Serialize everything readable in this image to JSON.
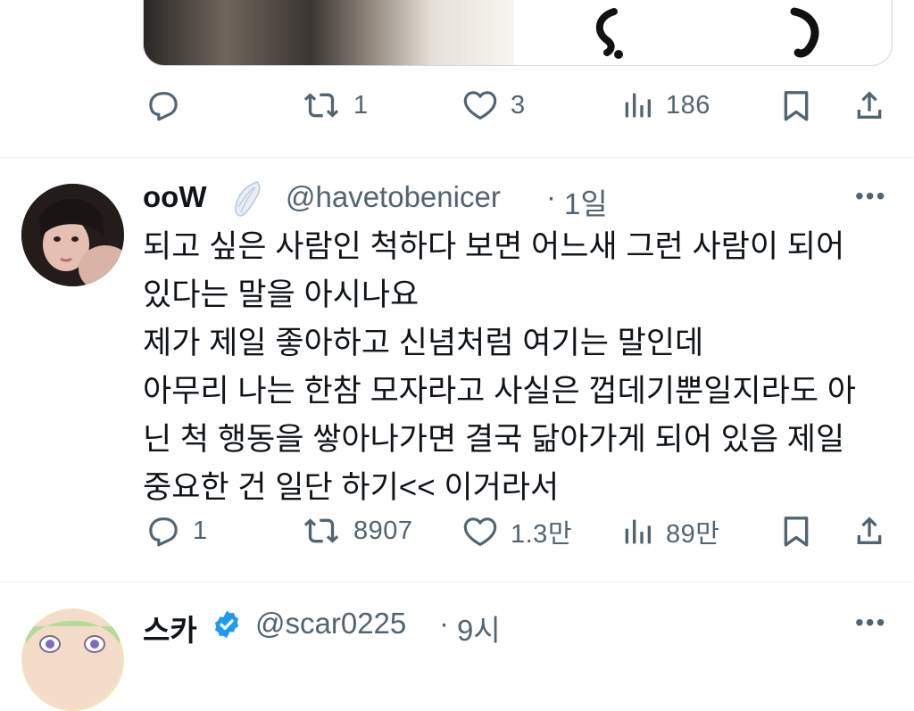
{
  "tweet1": {
    "stats": {
      "reply": "",
      "retweet": "1",
      "like": "3",
      "views": "186"
    }
  },
  "tweet2": {
    "name": "ooW",
    "handle": "@havetobenicer",
    "time": "1일",
    "text": "되고 싶은 사람인 척하다 보면 어느새 그런 사람이 되어\n있다는 말을 아시나요\n제가 제일 좋아하고 신념처럼 여기는 말인데\n아무리 나는 한참 모자라고 사실은 껍데기뿐일지라도 아\n닌 척 행동을 쌓아나가면 결국 닮아가게 되어 있음 제일\n중요한 건 일단 하기<< 이거라서",
    "stats": {
      "reply": "1",
      "retweet": "8907",
      "like": "1.3만",
      "views": "89만"
    }
  },
  "tweet3": {
    "name": "스카",
    "handle": "@scar0225",
    "time": "9시"
  },
  "sep": "·",
  "colors": {
    "muted": "#536471",
    "text": "#0f1419",
    "verified": "#1d9bf0",
    "border": "#eff3f4"
  },
  "icons": [
    "reply-icon",
    "retweet-icon",
    "like-icon",
    "views-icon",
    "bookmark-icon",
    "share-icon",
    "angel-wing-icon",
    "verified-badge-icon",
    "more-icon"
  ]
}
